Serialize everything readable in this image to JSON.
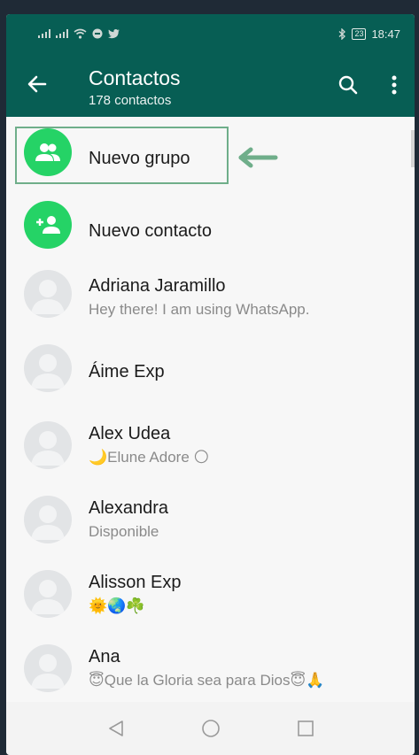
{
  "status_bar": {
    "left_icons": [
      "signal-icon",
      "signal-icon",
      "wifi-icon",
      "vpn-icon",
      "twitter-icon"
    ],
    "battery": "23",
    "time": "18:47"
  },
  "header": {
    "title": "Contactos",
    "subtitle": "178 contactos"
  },
  "actions": [
    {
      "label": "Nuevo grupo",
      "icon": "group-icon"
    },
    {
      "label": "Nuevo contacto",
      "icon": "add-contact-icon"
    }
  ],
  "contacts": [
    {
      "name": "Adriana Jaramillo",
      "status": "Hey there! I am using WhatsApp."
    },
    {
      "name": "Áime Exp",
      "status": ""
    },
    {
      "name": "Alex Udea",
      "status": "🌙Elune Adore 🌕"
    },
    {
      "name": "Alexandra",
      "status": "Disponible"
    },
    {
      "name": "Alisson Exp",
      "status": "🌞🌏☘️"
    },
    {
      "name": "Ana",
      "status": "😇Que la Gloria sea para Dios😇🙏"
    }
  ],
  "colors": {
    "header_bg": "#075e54",
    "accent_green": "#25d366",
    "highlight_border": "#6fae8a"
  },
  "nav_bar": [
    "back-triangle-icon",
    "home-circle-icon",
    "recents-square-icon"
  ]
}
